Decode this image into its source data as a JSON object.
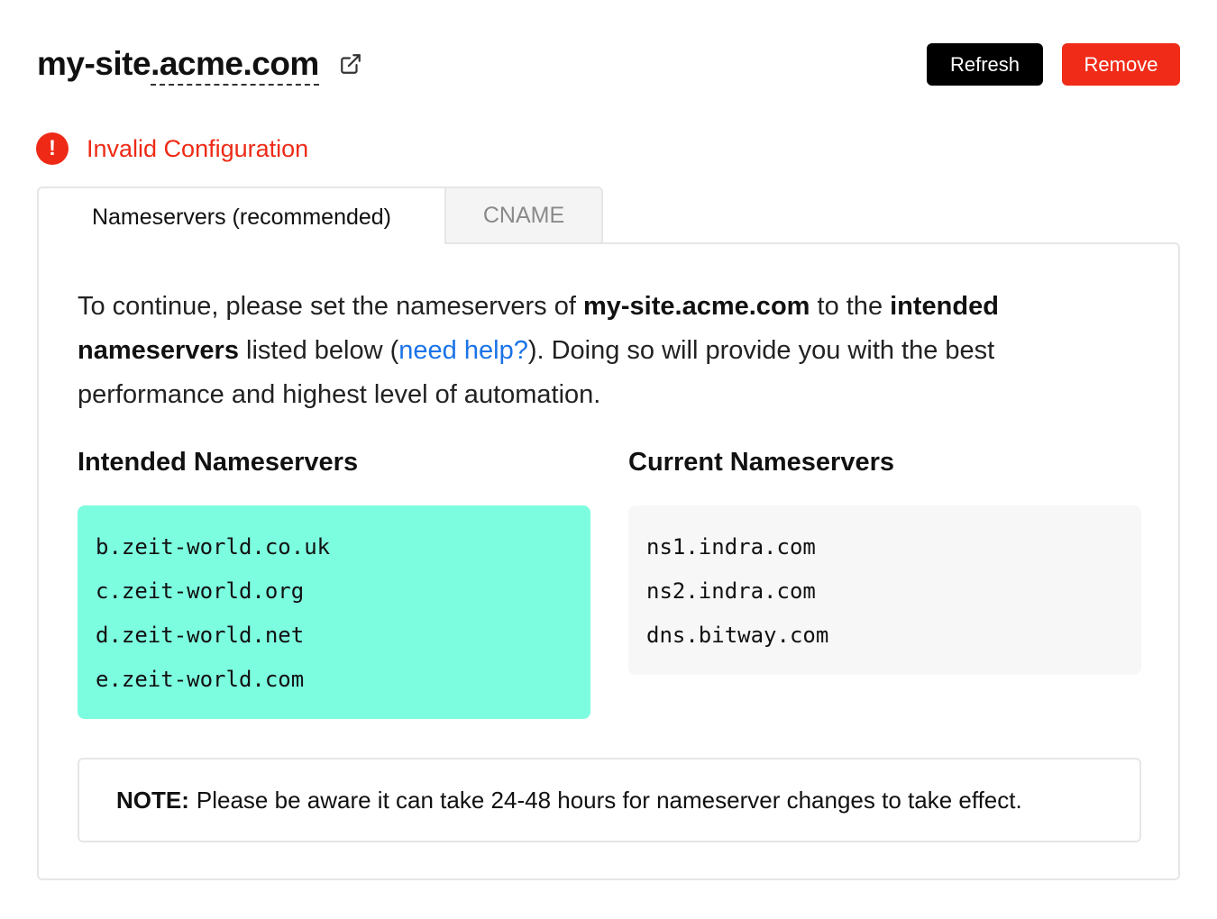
{
  "header": {
    "domain_prefix": "my-site",
    "domain_rest": ".acme.com",
    "refresh_label": "Refresh",
    "remove_label": "Remove"
  },
  "status": {
    "icon": "!",
    "text": "Invalid Configuration"
  },
  "tabs": [
    {
      "label": "Nameservers (recommended)",
      "active": true
    },
    {
      "label": "CNAME",
      "active": false
    }
  ],
  "intro": {
    "part1": "To continue, please set the nameservers of ",
    "domain": "my-site.acme.com",
    "part2": " to the ",
    "intended_bold": "intended nameservers",
    "part3": " listed below (",
    "help_link": "need help?",
    "part4": "). Doing so will provide you with the best performance and highest level of automation."
  },
  "intended": {
    "heading": "Intended Nameservers",
    "servers": [
      "b.zeit-world.co.uk",
      "c.zeit-world.org",
      "d.zeit-world.net",
      "e.zeit-world.com"
    ]
  },
  "current": {
    "heading": "Current Nameservers",
    "servers": [
      "ns1.indra.com",
      "ns2.indra.com",
      "dns.bitway.com"
    ]
  },
  "note": {
    "label": "NOTE:",
    "text": "Please be aware it can take 24-48 hours for nameserver changes to take effect."
  },
  "colors": {
    "error": "#ee2a16",
    "remove_button": "#f02b18",
    "refresh_button": "#000000",
    "intended_bg": "#7dfde0",
    "current_bg": "#f7f7f7",
    "link": "#1a73e8"
  },
  "icons": {
    "external_link": "external-link-icon",
    "status": "error-icon"
  }
}
